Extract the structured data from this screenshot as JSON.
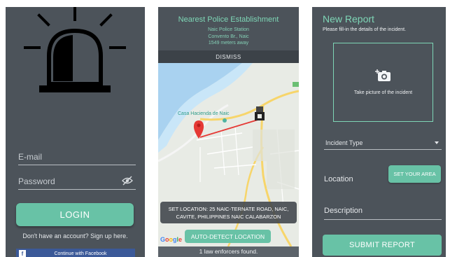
{
  "colors": {
    "panel": "#4c535a",
    "accent": "#68c2a6",
    "accent_text": "#7ed6b6",
    "facebook": "#3b5998"
  },
  "login": {
    "email_placeholder": "E-mail",
    "password_placeholder": "Password",
    "login_label": "LOGIN",
    "signup_text": "Don't have an account? Sign up here.",
    "facebook_label": "Continue with Facebook",
    "facebook_icon_glyph": "f",
    "icons": [
      "alarm-siren-icon",
      "eye-off-icon",
      "facebook-icon"
    ]
  },
  "map_screen": {
    "title": "Nearest Police Establishment",
    "station": "Naic Police Station",
    "address": "Convento Br., Naic",
    "distance": "1549 meters away",
    "dismiss_label": "DISMISS",
    "place_label": "Casa Hacienda de Naic",
    "set_location": "SET LOCATION: 25 NAIC-TERNATE ROAD, NAIC, CAVITE, PHILIPPINES NAIC CALABARZON",
    "auto_detect_label": "AUTO-DETECT LOCATION",
    "google_label": "Google",
    "found_text": "1 law enforcers found.",
    "icons": [
      "map-pin-icon",
      "police-marker-icon"
    ]
  },
  "report": {
    "title": "New Report",
    "subtitle": "Please fill-in the details of the incident.",
    "photo_label": "Take picture of the incident",
    "incident_type_label": "Incident Type",
    "location_label": "Location",
    "set_area_label": "SET YOUR AREA",
    "description_label": "Description",
    "submit_label": "SUBMIT REPORT",
    "icons": [
      "camera-add-icon",
      "dropdown-caret-icon"
    ]
  }
}
